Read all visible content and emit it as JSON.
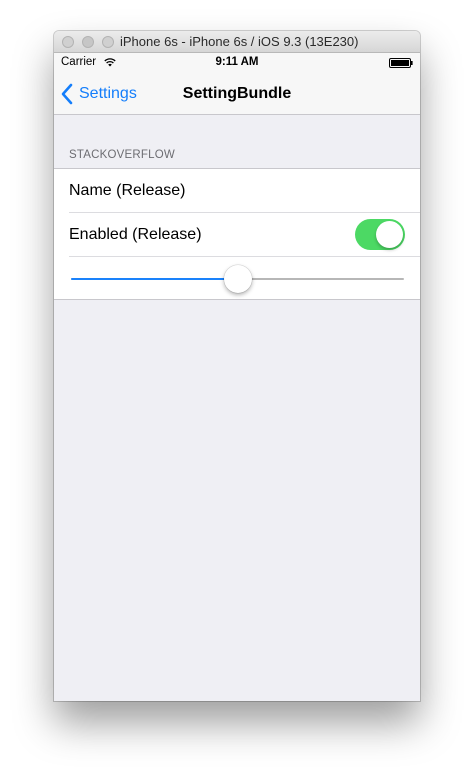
{
  "window": {
    "title": "iPhone 6s - iPhone 6s / iOS 9.3 (13E230)"
  },
  "status_bar": {
    "carrier": "Carrier",
    "time": "9:11 AM",
    "icons": [
      "wifi-icon",
      "battery-icon"
    ]
  },
  "nav_bar": {
    "back_label": "Settings",
    "title": "SettingBundle"
  },
  "section": {
    "header": "STACKOVERFLOW",
    "name_label": "Name (Release)",
    "enabled_label": "Enabled (Release)",
    "enabled_value": true,
    "slider_value": 0.5
  },
  "colors": {
    "tint": "#147efb",
    "toggle_on": "#4cd964",
    "background": "#efeff4"
  }
}
